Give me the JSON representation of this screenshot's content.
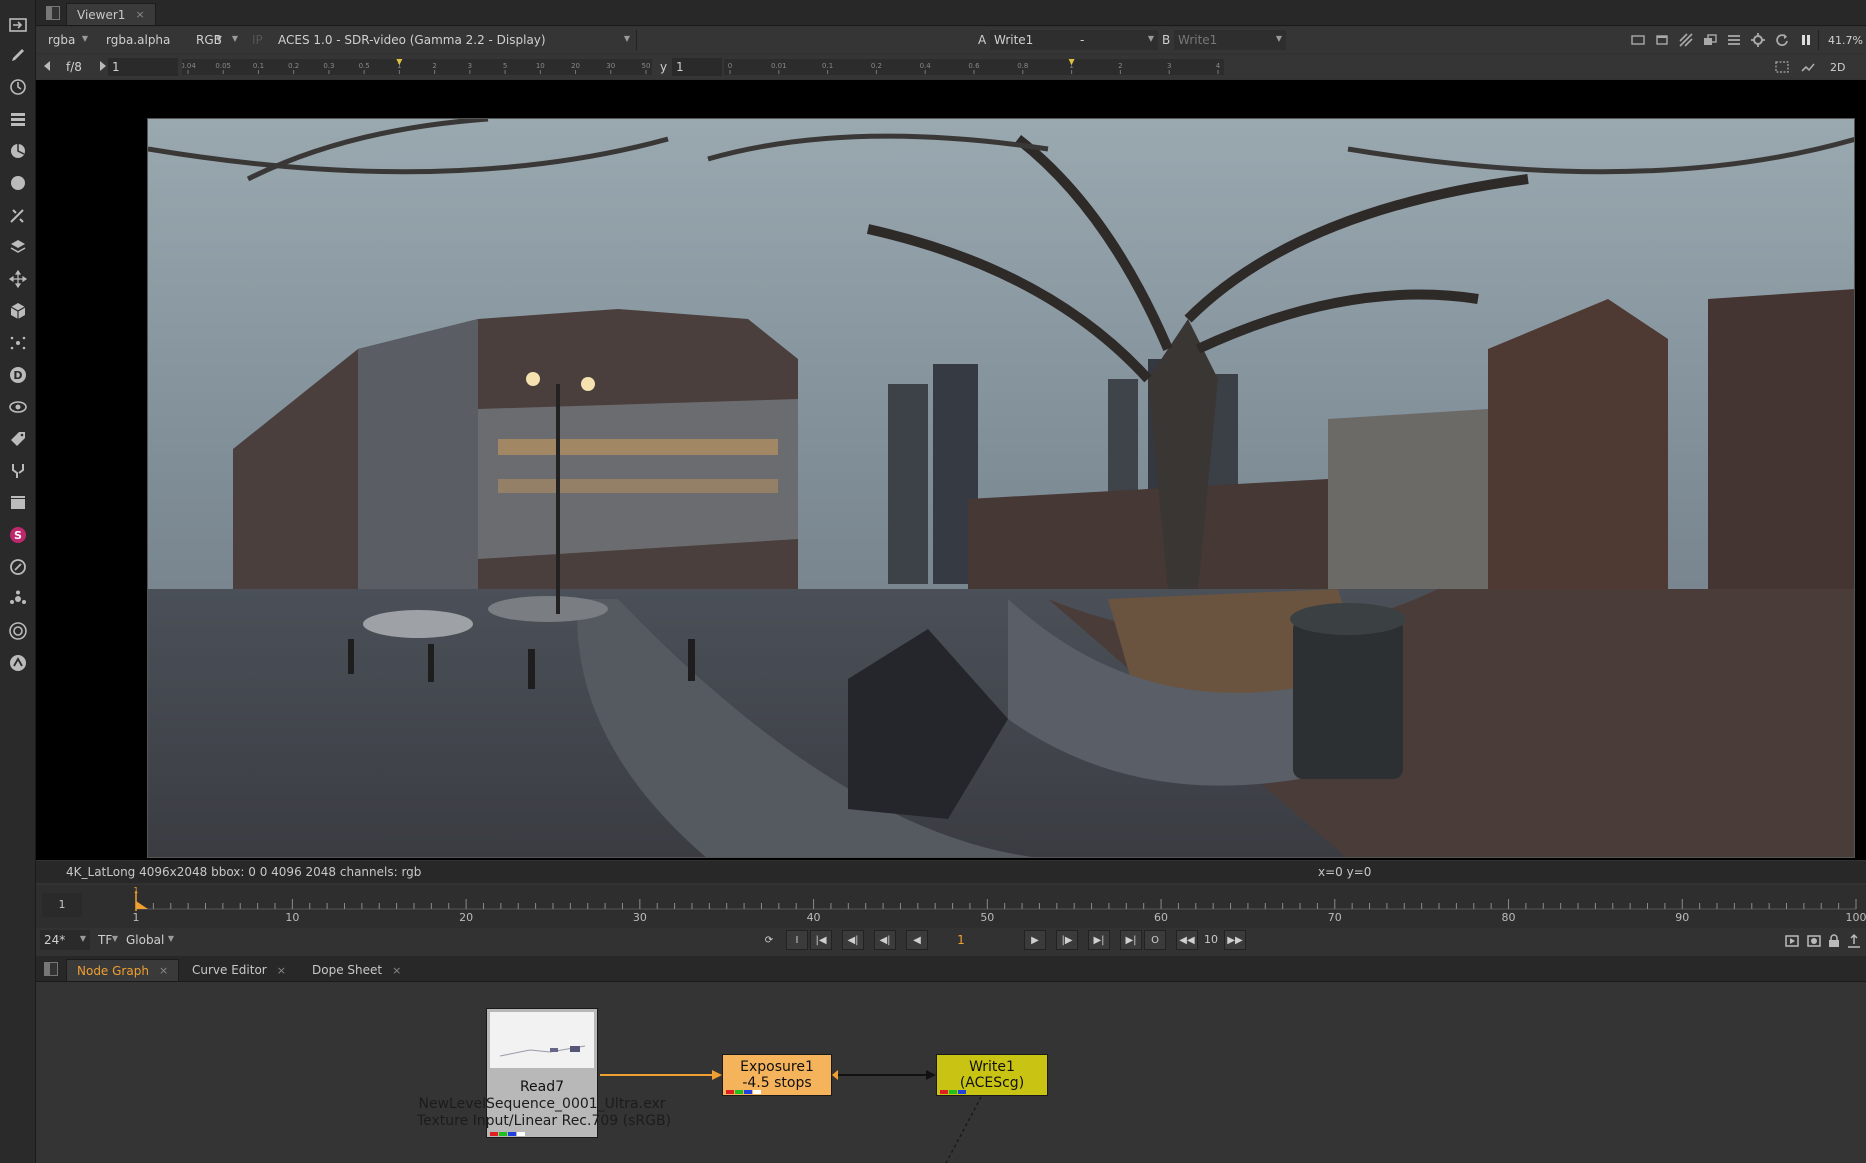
{
  "viewer_tab": {
    "label": "Viewer1",
    "close": "×"
  },
  "viewer_toolbar": {
    "channels": "rgba",
    "alpha_channel": "rgba.alpha",
    "display_channels": "RGB",
    "ip_label": "IP",
    "display_transform": "ACES 1.0 - SDR-video (Gamma 2.2 - Display)",
    "input_a_label": "A",
    "input_a": "Write1",
    "compare_mode": "-",
    "input_b_label": "B",
    "input_b": "Write1",
    "zoom": "41.7⁠%",
    "view_mode": "2D"
  },
  "exposure_bar": {
    "fstop": "f/8",
    "gain_value": "1",
    "gain_ticks": [
      "0.04",
      "0.05",
      "0.1",
      "0.2",
      "0.3",
      "0.5",
      "1",
      "2",
      "3",
      "5",
      "10",
      "20",
      "30",
      "50"
    ],
    "gamma_label": "y",
    "gamma_value": "1",
    "gamma_ticks": [
      "0",
      "0.01",
      "0.1",
      "0.2",
      "0.4",
      "0.6",
      "0.8",
      "1",
      "2",
      "3",
      "4"
    ]
  },
  "info_bar": {
    "format": "4K_LatLong 4096x2048  bbox: 0 0 4096 2048 channels: rgb",
    "coords": "x=0 y=0"
  },
  "timeline": {
    "in_frame": "1",
    "current_marker": "1",
    "ticks": [
      "1",
      "10",
      "20",
      "30",
      "40",
      "50",
      "60",
      "70",
      "80",
      "90",
      "100"
    ],
    "first_frame": 1,
    "last_frame": 100
  },
  "transport": {
    "fps": "24*",
    "timecode": "TF",
    "range": "Global",
    "current_frame": "1",
    "skip": "10"
  },
  "panels": {
    "tabs": [
      {
        "label": "Node Graph"
      },
      {
        "label": "Curve Editor"
      },
      {
        "label": "Dope Sheet"
      }
    ],
    "close": "×"
  },
  "nodes": {
    "read": {
      "name": "Read7",
      "file": "NewLevelSequence_0001_Ultra.exr",
      "colorspace": "Texture Input/Linear Rec.709 (sRGB)"
    },
    "exposure": {
      "name": "Exposure1",
      "value": "-4.5 stops"
    },
    "write": {
      "name": "Write1",
      "colorspace": "(ACEScg)"
    }
  },
  "colors": {
    "accent_orange": "#f0a030",
    "exposure_node": "#f5b35c",
    "write_node": "#c9c414",
    "read_node": "#b8b8b8",
    "active_tab_text": "#f0a030"
  }
}
